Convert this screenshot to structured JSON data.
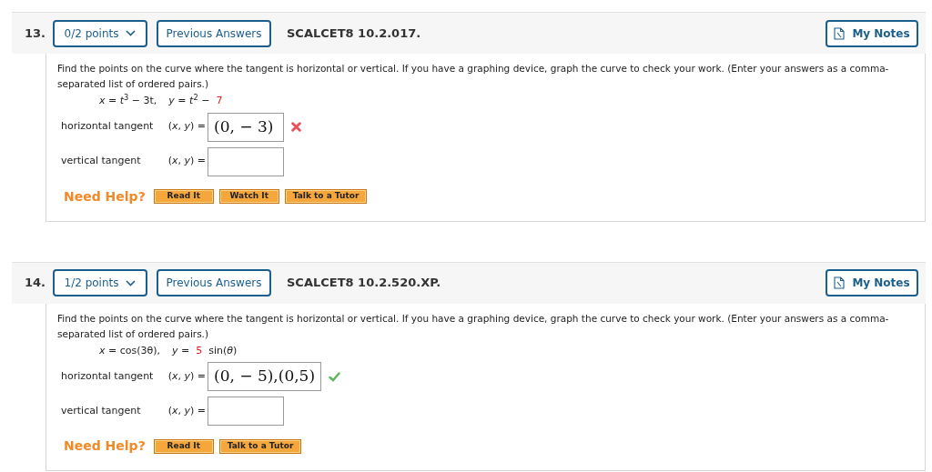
{
  "questions": [
    {
      "number": "13.",
      "points": "0/2 points",
      "previous": "Previous Answers",
      "code": "SCALCET8 10.2.017.",
      "notes": "My Notes",
      "prompt": "Find the points on the curve where the tangent is horizontal or vertical. If you have a graphing device, graph the curve to check your work. (Enter your answers as a comma-separated list of ordered pairs.)",
      "equation": [
        {
          "kind": "plain",
          "text": "*x* = *t*$^{3}$ − 3t,"
        },
        {
          "kind": "plain",
          "text": "*y* = *t*$^{2}$ −"
        },
        {
          "kind": "highlight",
          "text": "7"
        }
      ],
      "answers": [
        {
          "label": "horizontal tangent",
          "pair": "(*x*, *y*) =",
          "value": "(0, − 3)",
          "kind": "incorrect"
        },
        {
          "label": "vertical tangent",
          "pair": "(*x*, *y*) =",
          "kind": "blank"
        }
      ],
      "help": {
        "label": "Need Help?",
        "buttons": [
          "Read It",
          "Watch It",
          "Talk to a Tutor"
        ]
      }
    },
    {
      "number": "14.",
      "points": "1/2 points",
      "previous": "Previous Answers",
      "code": "SCALCET8 10.2.520.XP.",
      "notes": "My Notes",
      "prompt": "Find the points on the curve where the tangent is horizontal or vertical. If you have a graphing device, graph the curve to check your work. (Enter your answers as a comma-separated list of ordered pairs.)",
      "equation": [
        {
          "kind": "plain",
          "text": "*x* = cos(3θ),"
        },
        {
          "kind": "plain",
          "text": "*y* ="
        },
        {
          "kind": "highlight",
          "text": "5"
        },
        {
          "kind": "plain",
          "text": "sin(*θ*)"
        }
      ],
      "answers": [
        {
          "label": "horizontal tangent",
          "pair": "(*x*, *y*) =",
          "value": "(0, − 5),(0,5)",
          "kind": "correct"
        },
        {
          "label": "vertical tangent",
          "pair": "(*x*, *y*) =",
          "kind": "blank"
        }
      ],
      "help": {
        "label": "Need Help?",
        "buttons": [
          "Read It",
          "Talk to a Tutor"
        ]
      }
    }
  ]
}
